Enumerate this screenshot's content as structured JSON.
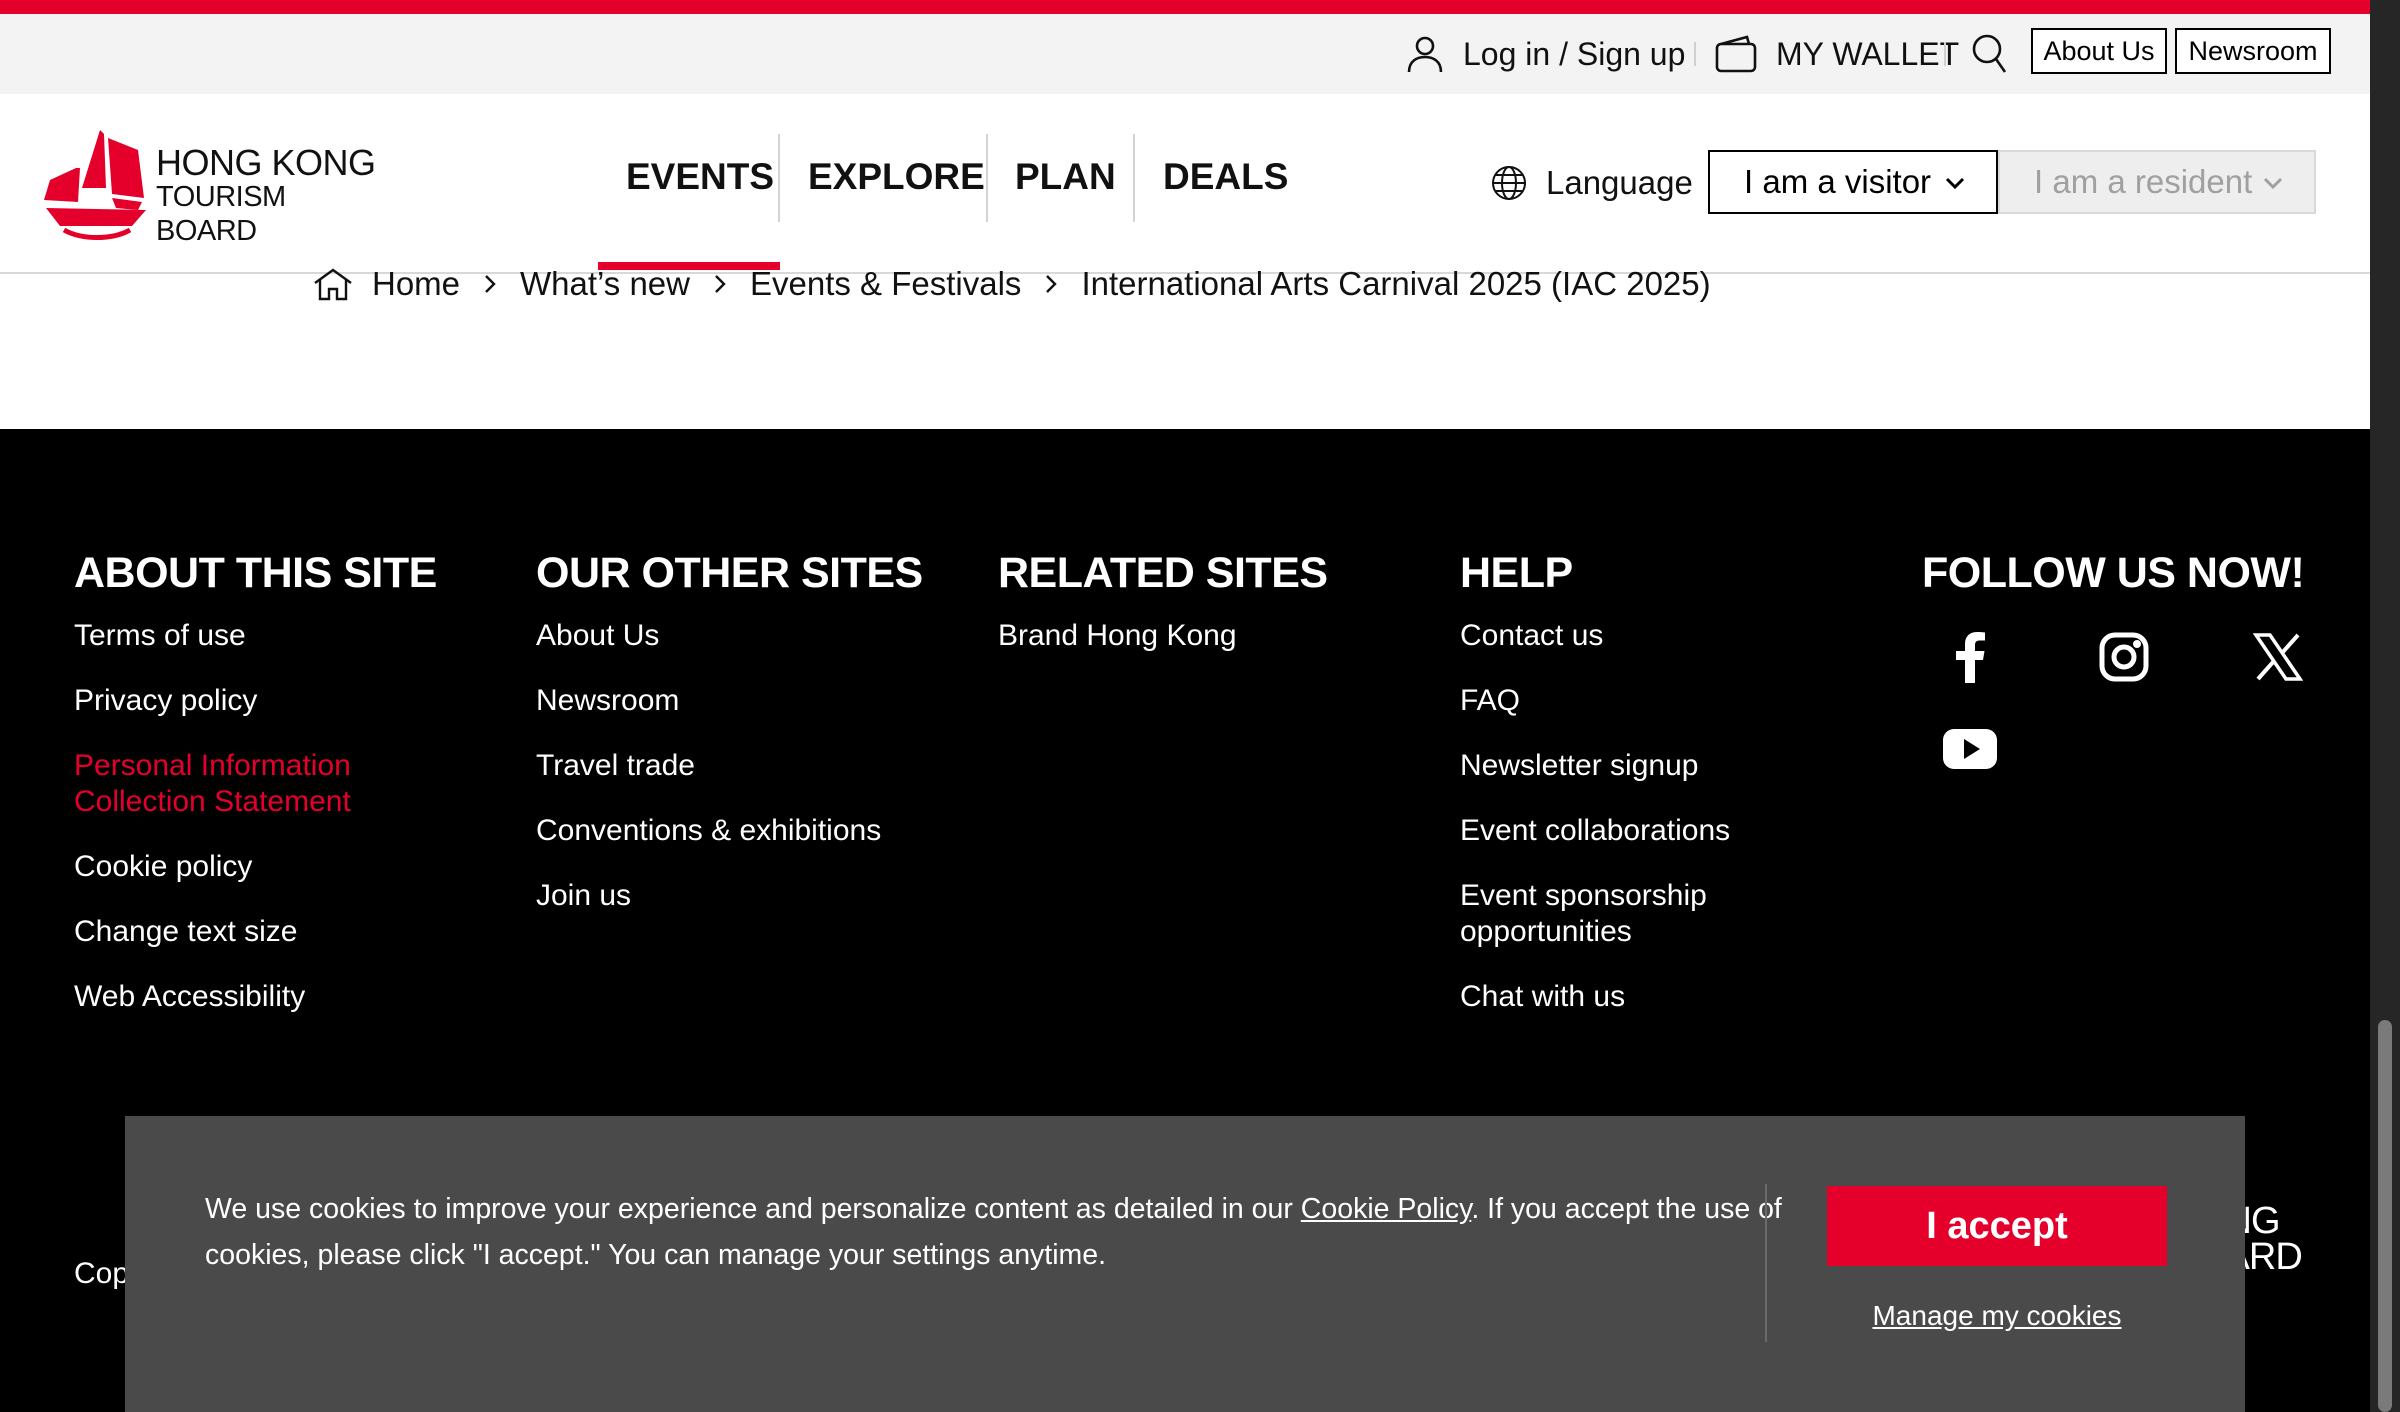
{
  "utility": {
    "login_label": "Log in / Sign up",
    "wallet_label": "MY WALLET",
    "about_label": "About Us",
    "newsroom_label": "Newsroom"
  },
  "header": {
    "logo_line1": "HONG KONG",
    "logo_line2": "TOURISM BOARD",
    "nav": [
      "EVENTS",
      "EXPLORE",
      "PLAN",
      "DEALS"
    ],
    "active_nav": "EVENTS",
    "language_label": "Language",
    "visitor_select": "I am a visitor",
    "resident_select": "I am a resident"
  },
  "breadcrumb": [
    "Home",
    "What’s new",
    "Events & Festivals",
    "International Arts Carnival 2025 (IAC 2025)"
  ],
  "footer": {
    "about": {
      "title": "ABOUT THIS SITE",
      "links": [
        "Terms of use",
        "Privacy policy",
        "Personal Information Collection Statement",
        "Cookie policy",
        "Change text size",
        "Web Accessibility"
      ]
    },
    "other_sites": {
      "title": "OUR OTHER SITES",
      "links": [
        "About Us",
        "Newsroom",
        "Travel trade",
        "Conventions & exhibitions",
        "Join us"
      ]
    },
    "related": {
      "title": "RELATED SITES",
      "links": [
        "Brand Hong Kong"
      ]
    },
    "help": {
      "title": "HELP",
      "links": [
        "Contact us",
        "FAQ",
        "Newsletter signup",
        "Event collaborations",
        "Event sponsorship opportunities",
        "Chat with us"
      ]
    },
    "follow": {
      "title": "FOLLOW US NOW!",
      "icons": [
        "facebook-icon",
        "instagram-icon",
        "x-icon",
        "youtube-icon"
      ]
    },
    "copyright_partial": "Cop",
    "logo_partial_1": "ONG",
    "logo_partial_2": "OARD"
  },
  "cookie": {
    "text_before": "We use cookies to improve your experience and personalize content as detailed in our ",
    "link": "Cookie Policy",
    "text_after": ". If you accept the use of cookies, please click \"I accept.\" You can manage your settings anytime.",
    "accept_label": "I accept",
    "manage_label": "Manage my cookies"
  },
  "colors": {
    "brand_red": "#e4002b",
    "footer_bg": "#000000",
    "cookie_bg": "#4a4a4a"
  }
}
